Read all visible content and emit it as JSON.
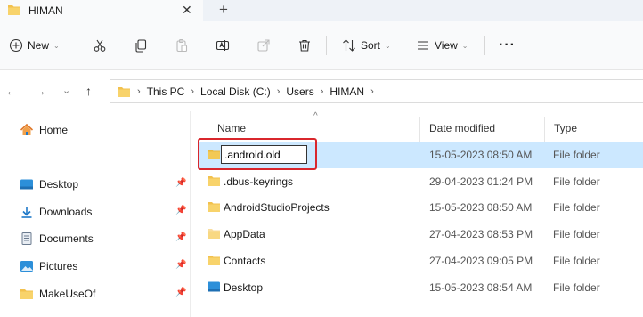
{
  "window": {
    "tab_title": "HIMAN",
    "tab_close": "✕",
    "new_tab": "+"
  },
  "toolbar": {
    "new_label": "New",
    "sort_label": "Sort",
    "view_label": "View",
    "more_label": "···",
    "caret": "⌄"
  },
  "nav": {
    "back": "←",
    "forward": "→",
    "recent": "⌄",
    "up": "↑"
  },
  "address": {
    "breadcrumbs": [
      "This PC",
      "Local Disk (C:)",
      "Users",
      "HIMAN"
    ],
    "sep": "›"
  },
  "sidebar": {
    "pin": "📌",
    "items": [
      {
        "label": "Home",
        "icon": "home-icon"
      },
      {
        "label": "Desktop",
        "icon": "desktop-icon",
        "pinned": true
      },
      {
        "label": "Downloads",
        "icon": "download-icon",
        "pinned": true
      },
      {
        "label": "Documents",
        "icon": "document-icon",
        "pinned": true
      },
      {
        "label": "Pictures",
        "icon": "pictures-icon",
        "pinned": true
      },
      {
        "label": "MakeUseOf",
        "icon": "folder-icon",
        "pinned": true
      }
    ]
  },
  "columns": {
    "name": "Name",
    "date": "Date modified",
    "type": "Type",
    "sort_indicator": "^"
  },
  "files": {
    "rename_value": ".android.old",
    "rows": [
      {
        "name": ".android.old",
        "date": "15-05-2023 08:50 AM",
        "type": "File folder",
        "selected": true
      },
      {
        "name": ".dbus-keyrings",
        "date": "29-04-2023 01:24 PM",
        "type": "File folder"
      },
      {
        "name": "AndroidStudioProjects",
        "date": "15-05-2023 08:50 AM",
        "type": "File folder"
      },
      {
        "name": "AppData",
        "date": "27-04-2023 08:53 PM",
        "type": "File folder"
      },
      {
        "name": "Contacts",
        "date": "27-04-2023 09:05 PM",
        "type": "File folder"
      },
      {
        "name": "Desktop",
        "date": "15-05-2023 08:54 AM",
        "type": "File folder"
      }
    ]
  },
  "colors": {
    "folder": "#f2c14e",
    "selection": "#cce8ff",
    "highlight": "#d9262c",
    "accent": "#0067c0"
  }
}
